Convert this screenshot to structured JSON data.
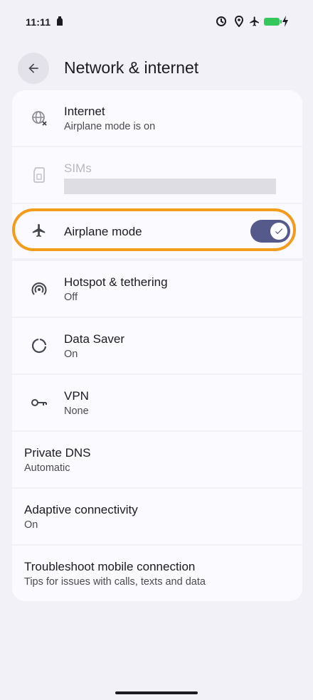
{
  "status_bar": {
    "time": "11:11"
  },
  "header": {
    "title": "Network & internet"
  },
  "items": [
    {
      "title": "Internet",
      "subtitle": "Airplane mode is on"
    },
    {
      "title": "SIMs"
    },
    {
      "title": "Airplane mode",
      "toggle_on": true
    },
    {
      "title": "Hotspot & tethering",
      "subtitle": "Off"
    },
    {
      "title": "Data Saver",
      "subtitle": "On"
    },
    {
      "title": "VPN",
      "subtitle": "None"
    },
    {
      "title": "Private DNS",
      "subtitle": "Automatic"
    },
    {
      "title": "Adaptive connectivity",
      "subtitle": "On"
    },
    {
      "title": "Troubleshoot mobile connection",
      "subtitle": "Tips for issues with calls, texts and data"
    }
  ],
  "colors": {
    "background": "#f2f1f8",
    "card": "#fbfaff",
    "toggle_on": "#565a8a",
    "highlight": "#f39b1b"
  }
}
